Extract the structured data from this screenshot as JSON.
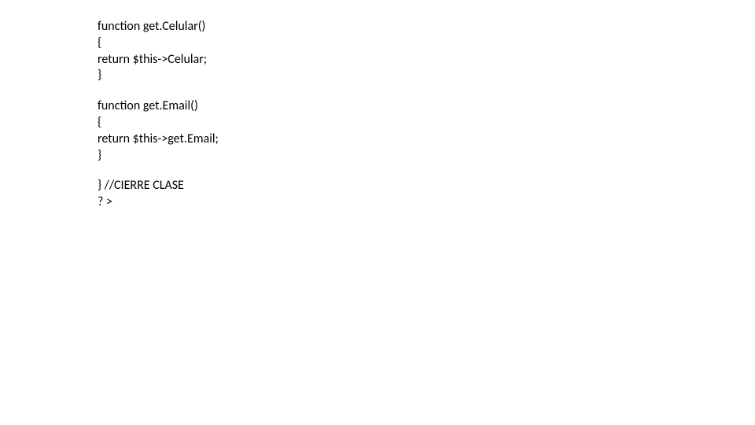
{
  "blocks": [
    {
      "lines": [
        "function get.Celular()",
        "{",
        "return $this->Celular;",
        "}"
      ]
    },
    {
      "lines": [
        "function get.Email()",
        "{",
        "return $this->get.Email;",
        "}"
      ]
    },
    {
      "lines": [
        "} //CIERRE CLASE",
        "? >"
      ]
    }
  ]
}
